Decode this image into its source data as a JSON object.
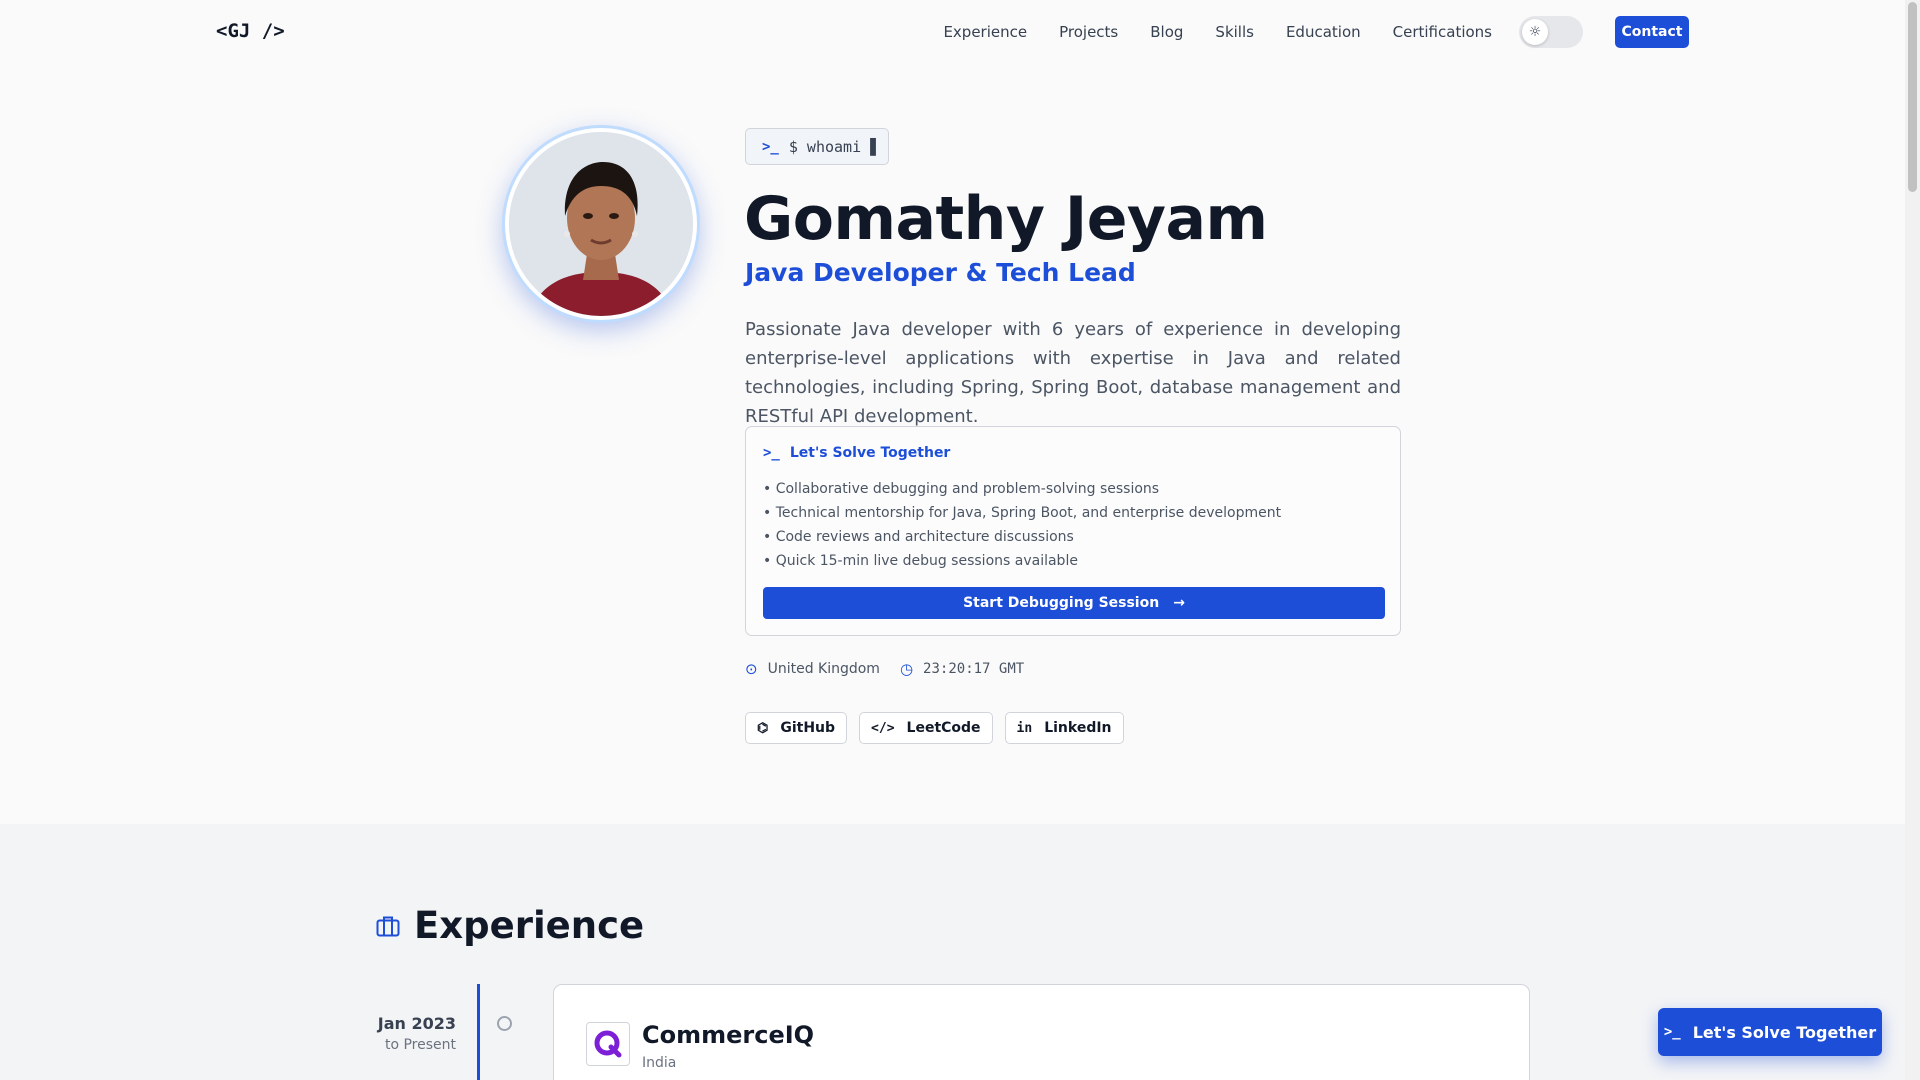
{
  "nav": {
    "logo": "<GJ />",
    "links": [
      "Experience",
      "Projects",
      "Blog",
      "Skills",
      "Education",
      "Certifications"
    ],
    "theme_icon": "sun-icon",
    "contact_label": "Contact"
  },
  "hero": {
    "terminal": "$ whoami ▋",
    "name": "Gomathy Jeyam",
    "role": "Java Developer & Tech Lead",
    "description": "Passionate Java developer with 6 years of experience in developing enterprise-level applications with expertise in Java and related technologies, including Spring, Spring Boot, database management and RESTful API development.",
    "solve": {
      "title": "Let's Solve Together",
      "items": [
        "• Collaborative debugging and problem-solving sessions",
        "• Technical mentorship for Java, Spring Boot, and enterprise development",
        "• Code reviews and architecture discussions",
        "• Quick 15-min live debug sessions available"
      ],
      "button": "Start Debugging Session"
    },
    "location": "United Kingdom",
    "time": "23:20:17 GMT",
    "socials": [
      "GitHub",
      "LeetCode",
      "LinkedIn"
    ]
  },
  "experience": {
    "title": "Experience",
    "jobs": [
      {
        "date_start": "Jan 2023",
        "date_end": "to Present",
        "company": "CommerceIQ",
        "location": "India"
      }
    ]
  },
  "floating_button": "Let's Solve Together",
  "colors": {
    "accent": "#1d4ed8",
    "text": "#111827",
    "muted": "#4b5563",
    "background": "#fafafa"
  }
}
